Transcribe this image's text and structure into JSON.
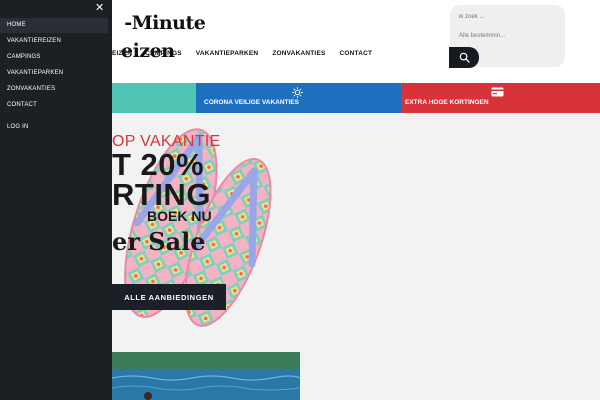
{
  "header": {
    "logo_line1": "-Minute",
    "logo_line2": "eizen",
    "nav": [
      "EIZEN",
      "CAMPINGS",
      "VAKANTIEPARKEN",
      "ZONVAKANTIES",
      "CONTACT"
    ],
    "search_placeholder": "ik zoek ...",
    "select_label": "Alle bestemmin...",
    "search_icon": "search-icon"
  },
  "bands": {
    "teal_label": "",
    "blue_label": "CORONA VEILIGE VAKANTIES",
    "blue_icon": "sun-icon",
    "red_label": "EXTRA HOGE KORTINGEN",
    "red_icon": "card-icon"
  },
  "hero": {
    "line1": "OP VAKANTIE",
    "line2": "T 20%",
    "line3": "RTING",
    "line4": "BOEK NU",
    "line5": "er Sale",
    "cta": "ALLE AANBIEDINGEN"
  },
  "drawer": {
    "close_icon": "close-icon",
    "items": [
      "HOME",
      "VAKANTIEREIZEN",
      "CAMPINGS",
      "VAKANTIEPARKEN",
      "ZONVAKANTIES",
      "CONTACT",
      "LOG IN"
    ],
    "active_index": 0
  },
  "colors": {
    "drawer_bg": "#1c1f24",
    "teal": "#4fc3b4",
    "blue": "#1f6fbf",
    "red": "#d9333a",
    "accent_text": "#d3363d"
  }
}
